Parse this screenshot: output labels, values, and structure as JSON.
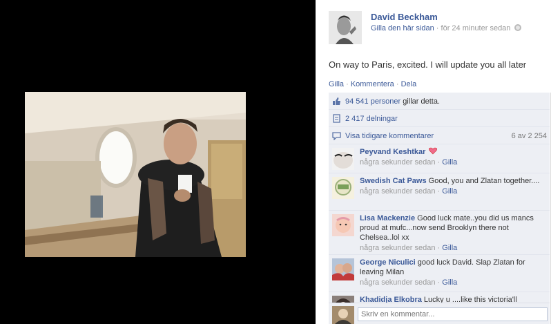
{
  "post": {
    "page_name": "David Beckham",
    "like_page_label": "Gilla den här sidan",
    "separator": "·",
    "time": "för 24 minuter sedan",
    "status": "On way to Paris, excited. I will update you all later"
  },
  "actions": {
    "like": "Gilla",
    "comment": "Kommentera",
    "share": "Dela",
    "sep": "·"
  },
  "likes": {
    "count": "94 541 personer",
    "suffix": "gillar detta."
  },
  "shares": {
    "label": "2 417 delningar"
  },
  "older_comments": {
    "label": "Visa tidigare kommentarer",
    "count": "6 av 2 254"
  },
  "comments": [
    {
      "name": "Peyvand Keshtkar",
      "text": "",
      "time": "några sekunder sedan",
      "like": "Gilla"
    },
    {
      "name": "Swedish Cat Paws",
      "text": "Good, you and Zlatan together....",
      "time": "några sekunder sedan",
      "like": "Gilla"
    },
    {
      "name": "Lisa Mackenzie",
      "text": "Good luck mate..you did us mancs proud at mufc...now send Brooklyn there not Chelsea..lol xx",
      "time": "några sekunder sedan",
      "like": "Gilla"
    },
    {
      "name": "George Niculici",
      "text": "good luck David. Slap Zlatan for leaving Milan",
      "time": "några sekunder sedan",
      "like": "Gilla"
    },
    {
      "name": "Khadidja Elkobra",
      "text": "Lucky u ....like this victoria'll",
      "time": "",
      "like": ""
    }
  ],
  "composer": {
    "placeholder": "Skriv en kommentar..."
  },
  "colors": {
    "link": "#3b5998",
    "ufi_bg": "#edeff4",
    "viewer_bg": "#000000"
  },
  "icons": {
    "like": "thumbs-up-icon",
    "share": "share-icon",
    "comment": "comment-bubble-icon",
    "globe": "globe-icon",
    "heart": "heart-icon"
  }
}
